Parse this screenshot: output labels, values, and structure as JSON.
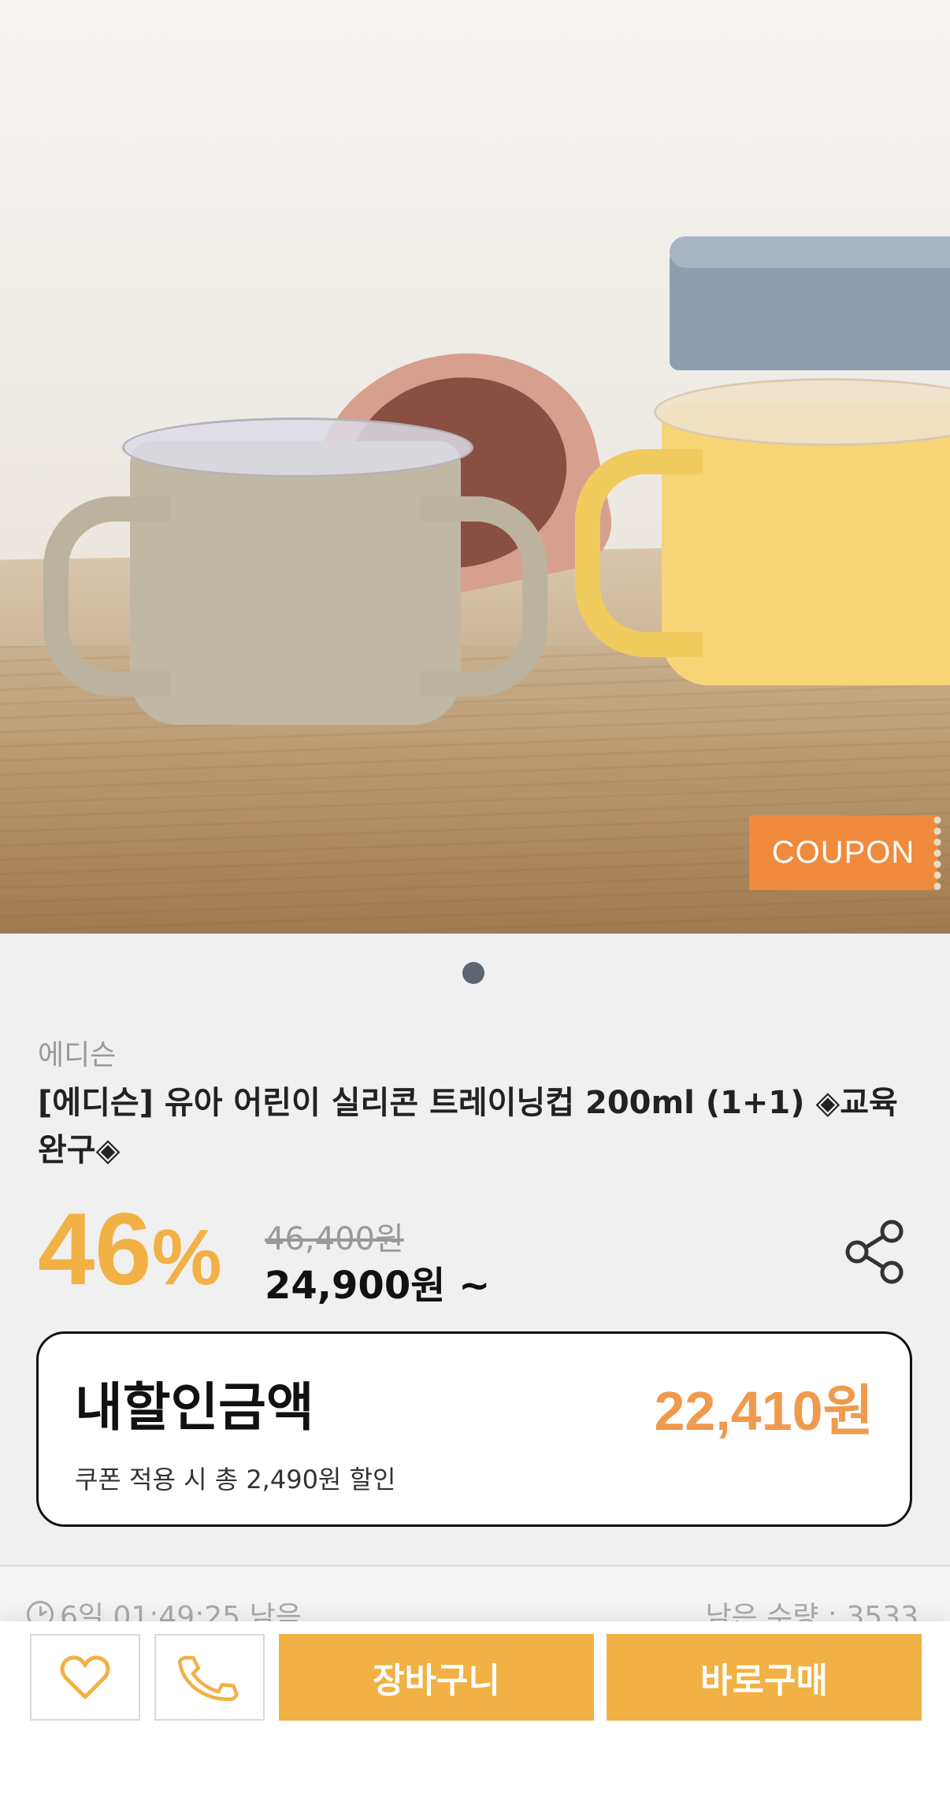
{
  "hero": {
    "coupon_label": "COUPON",
    "image_alt": ""
  },
  "product": {
    "brand": "에디슨",
    "title": "[에디슨] 유아 어린이 실리콘 트레이닝컵 200ml (1+1) ◈교육완구◈",
    "discount_rate": "46",
    "discount_unit": "%",
    "original_price": "46,400원",
    "sale_price": "24,900원 ~"
  },
  "my_discount": {
    "label": "내할인금액",
    "amount": "22,410원",
    "description": "쿠폰 적용 시 총 2,490원 할인"
  },
  "deal": {
    "time_left": "6일 01:49:25 남음",
    "stock": "남은 수량 : 3533"
  },
  "bottom_bar": {
    "cart_label": "장바구니",
    "buy_label": "바로구매"
  },
  "colors": {
    "accent": "#f2b144",
    "coupon": "#f08a3c",
    "discount_amount": "#f09a4e"
  }
}
